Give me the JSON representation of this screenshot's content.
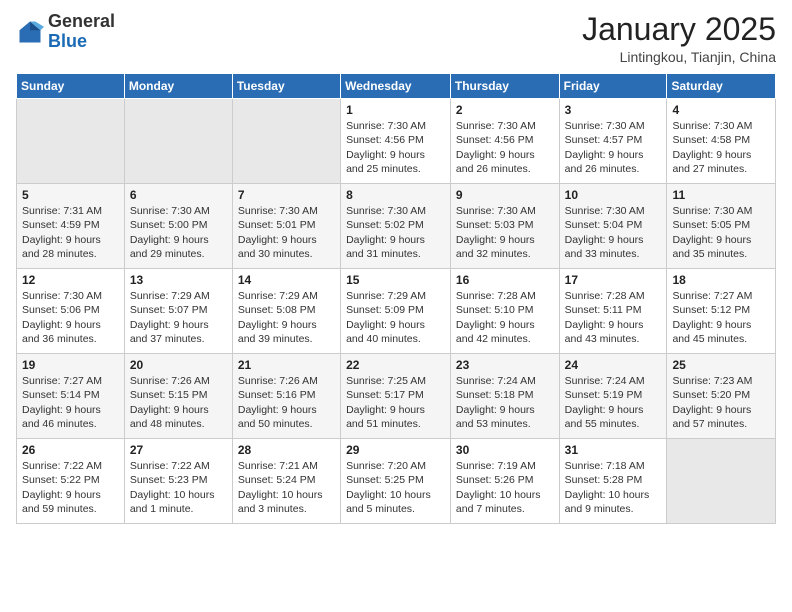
{
  "header": {
    "logo_general": "General",
    "logo_blue": "Blue",
    "month_title": "January 2025",
    "location": "Lintingkou, Tianjin, China"
  },
  "weekdays": [
    "Sunday",
    "Monday",
    "Tuesday",
    "Wednesday",
    "Thursday",
    "Friday",
    "Saturday"
  ],
  "weeks": [
    [
      {
        "day": "",
        "info": ""
      },
      {
        "day": "",
        "info": ""
      },
      {
        "day": "",
        "info": ""
      },
      {
        "day": "1",
        "info": "Sunrise: 7:30 AM\nSunset: 4:56 PM\nDaylight: 9 hours\nand 25 minutes."
      },
      {
        "day": "2",
        "info": "Sunrise: 7:30 AM\nSunset: 4:56 PM\nDaylight: 9 hours\nand 26 minutes."
      },
      {
        "day": "3",
        "info": "Sunrise: 7:30 AM\nSunset: 4:57 PM\nDaylight: 9 hours\nand 26 minutes."
      },
      {
        "day": "4",
        "info": "Sunrise: 7:30 AM\nSunset: 4:58 PM\nDaylight: 9 hours\nand 27 minutes."
      }
    ],
    [
      {
        "day": "5",
        "info": "Sunrise: 7:31 AM\nSunset: 4:59 PM\nDaylight: 9 hours\nand 28 minutes."
      },
      {
        "day": "6",
        "info": "Sunrise: 7:30 AM\nSunset: 5:00 PM\nDaylight: 9 hours\nand 29 minutes."
      },
      {
        "day": "7",
        "info": "Sunrise: 7:30 AM\nSunset: 5:01 PM\nDaylight: 9 hours\nand 30 minutes."
      },
      {
        "day": "8",
        "info": "Sunrise: 7:30 AM\nSunset: 5:02 PM\nDaylight: 9 hours\nand 31 minutes."
      },
      {
        "day": "9",
        "info": "Sunrise: 7:30 AM\nSunset: 5:03 PM\nDaylight: 9 hours\nand 32 minutes."
      },
      {
        "day": "10",
        "info": "Sunrise: 7:30 AM\nSunset: 5:04 PM\nDaylight: 9 hours\nand 33 minutes."
      },
      {
        "day": "11",
        "info": "Sunrise: 7:30 AM\nSunset: 5:05 PM\nDaylight: 9 hours\nand 35 minutes."
      }
    ],
    [
      {
        "day": "12",
        "info": "Sunrise: 7:30 AM\nSunset: 5:06 PM\nDaylight: 9 hours\nand 36 minutes."
      },
      {
        "day": "13",
        "info": "Sunrise: 7:29 AM\nSunset: 5:07 PM\nDaylight: 9 hours\nand 37 minutes."
      },
      {
        "day": "14",
        "info": "Sunrise: 7:29 AM\nSunset: 5:08 PM\nDaylight: 9 hours\nand 39 minutes."
      },
      {
        "day": "15",
        "info": "Sunrise: 7:29 AM\nSunset: 5:09 PM\nDaylight: 9 hours\nand 40 minutes."
      },
      {
        "day": "16",
        "info": "Sunrise: 7:28 AM\nSunset: 5:10 PM\nDaylight: 9 hours\nand 42 minutes."
      },
      {
        "day": "17",
        "info": "Sunrise: 7:28 AM\nSunset: 5:11 PM\nDaylight: 9 hours\nand 43 minutes."
      },
      {
        "day": "18",
        "info": "Sunrise: 7:27 AM\nSunset: 5:12 PM\nDaylight: 9 hours\nand 45 minutes."
      }
    ],
    [
      {
        "day": "19",
        "info": "Sunrise: 7:27 AM\nSunset: 5:14 PM\nDaylight: 9 hours\nand 46 minutes."
      },
      {
        "day": "20",
        "info": "Sunrise: 7:26 AM\nSunset: 5:15 PM\nDaylight: 9 hours\nand 48 minutes."
      },
      {
        "day": "21",
        "info": "Sunrise: 7:26 AM\nSunset: 5:16 PM\nDaylight: 9 hours\nand 50 minutes."
      },
      {
        "day": "22",
        "info": "Sunrise: 7:25 AM\nSunset: 5:17 PM\nDaylight: 9 hours\nand 51 minutes."
      },
      {
        "day": "23",
        "info": "Sunrise: 7:24 AM\nSunset: 5:18 PM\nDaylight: 9 hours\nand 53 minutes."
      },
      {
        "day": "24",
        "info": "Sunrise: 7:24 AM\nSunset: 5:19 PM\nDaylight: 9 hours\nand 55 minutes."
      },
      {
        "day": "25",
        "info": "Sunrise: 7:23 AM\nSunset: 5:20 PM\nDaylight: 9 hours\nand 57 minutes."
      }
    ],
    [
      {
        "day": "26",
        "info": "Sunrise: 7:22 AM\nSunset: 5:22 PM\nDaylight: 9 hours\nand 59 minutes."
      },
      {
        "day": "27",
        "info": "Sunrise: 7:22 AM\nSunset: 5:23 PM\nDaylight: 10 hours\nand 1 minute."
      },
      {
        "day": "28",
        "info": "Sunrise: 7:21 AM\nSunset: 5:24 PM\nDaylight: 10 hours\nand 3 minutes."
      },
      {
        "day": "29",
        "info": "Sunrise: 7:20 AM\nSunset: 5:25 PM\nDaylight: 10 hours\nand 5 minutes."
      },
      {
        "day": "30",
        "info": "Sunrise: 7:19 AM\nSunset: 5:26 PM\nDaylight: 10 hours\nand 7 minutes."
      },
      {
        "day": "31",
        "info": "Sunrise: 7:18 AM\nSunset: 5:28 PM\nDaylight: 10 hours\nand 9 minutes."
      },
      {
        "day": "",
        "info": ""
      }
    ]
  ]
}
